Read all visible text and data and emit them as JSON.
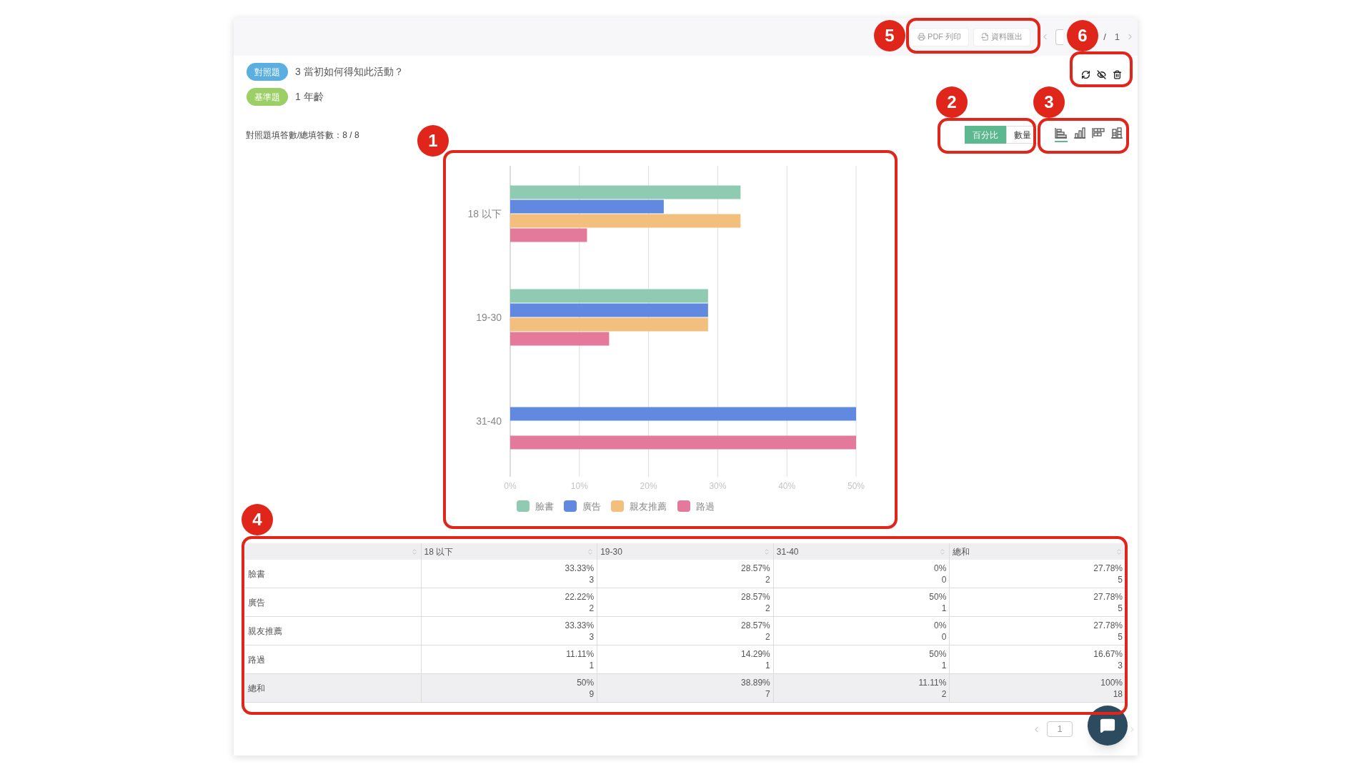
{
  "toolbar": {
    "buttons": [
      {
        "kind": "print",
        "label": "PDF 列印"
      },
      {
        "kind": "export",
        "label": "資料匯出"
      }
    ],
    "pager": {
      "separator": "/",
      "total": "1"
    }
  },
  "question_tags": [
    {
      "tag": "對照題",
      "color": "#5aaee0",
      "text": "3 當初如何得知此活動？"
    },
    {
      "tag": "基準題",
      "color": "#9ccf65",
      "text": "1 年齡"
    }
  ],
  "actions": [
    {
      "kind": "refresh"
    },
    {
      "kind": "hide"
    },
    {
      "kind": "delete"
    }
  ],
  "answer_count": "對照題填答數/總填答數：8 / 8",
  "display_toggle": [
    {
      "label": "百分比",
      "selected": true
    },
    {
      "label": "數量",
      "selected": false
    }
  ],
  "chart_types": [
    {
      "kind": "horizontal-bar",
      "selected": true
    },
    {
      "kind": "vertical-bar",
      "selected": false
    },
    {
      "kind": "horizontal-stacked",
      "selected": false
    },
    {
      "kind": "vertical-stacked",
      "selected": false
    }
  ],
  "chart": {
    "chart_data": {
      "type": "bar",
      "orientation": "horizontal",
      "categories": [
        "18 以下",
        "19-30",
        "31-40"
      ],
      "series": [
        {
          "name": "臉書",
          "color": "#8ecbb2",
          "values": [
            33.3,
            28.6,
            0
          ]
        },
        {
          "name": "廣告",
          "color": "#6189e0",
          "values": [
            22.2,
            28.6,
            50
          ]
        },
        {
          "name": "親友推薦",
          "color": "#f2bf7c",
          "values": [
            33.3,
            28.6,
            0
          ]
        },
        {
          "name": "路過",
          "color": "#e47a9b",
          "values": [
            11.1,
            14.3,
            50
          ]
        }
      ],
      "grid": true,
      "legend": true,
      "xlim": [
        0,
        50
      ],
      "xticks": [
        {
          "value": 0,
          "label": "0%"
        },
        {
          "value": 10,
          "label": "10%"
        },
        {
          "value": 20,
          "label": "20%"
        },
        {
          "value": 30,
          "label": "30%"
        },
        {
          "value": 40,
          "label": "40%"
        },
        {
          "value": 50,
          "label": "50%"
        }
      ]
    }
  },
  "table": {
    "columns": [
      "18 以下",
      "19-30",
      "31-40",
      "總和"
    ],
    "rows": [
      {
        "kind": "data",
        "label": "臉書",
        "cells": [
          [
            "33.33%",
            "3"
          ],
          [
            "28.57%",
            "2"
          ],
          [
            "0%",
            "0"
          ],
          [
            "27.78%",
            "5"
          ]
        ]
      },
      {
        "kind": "data",
        "label": "廣告",
        "cells": [
          [
            "22.22%",
            "2"
          ],
          [
            "28.57%",
            "2"
          ],
          [
            "50%",
            "1"
          ],
          [
            "27.78%",
            "5"
          ]
        ]
      },
      {
        "kind": "data",
        "label": "親友推薦",
        "cells": [
          [
            "33.33%",
            "3"
          ],
          [
            "28.57%",
            "2"
          ],
          [
            "0%",
            "0"
          ],
          [
            "27.78%",
            "5"
          ]
        ]
      },
      {
        "kind": "data",
        "label": "路過",
        "cells": [
          [
            "11.11%",
            "1"
          ],
          [
            "14.29%",
            "1"
          ],
          [
            "50%",
            "1"
          ],
          [
            "16.67%",
            "3"
          ]
        ]
      },
      {
        "kind": "total",
        "label": "總和",
        "cells": [
          [
            "50%",
            "9"
          ],
          [
            "38.89%",
            "7"
          ],
          [
            "11.11%",
            "2"
          ],
          [
            "100%",
            "18"
          ]
        ]
      }
    ]
  },
  "bottom_pager": {
    "page": "1"
  },
  "annotations": [
    {
      "number": "1"
    },
    {
      "number": "2"
    },
    {
      "number": "3"
    },
    {
      "number": "4"
    },
    {
      "number": "5"
    },
    {
      "number": "6"
    }
  ]
}
